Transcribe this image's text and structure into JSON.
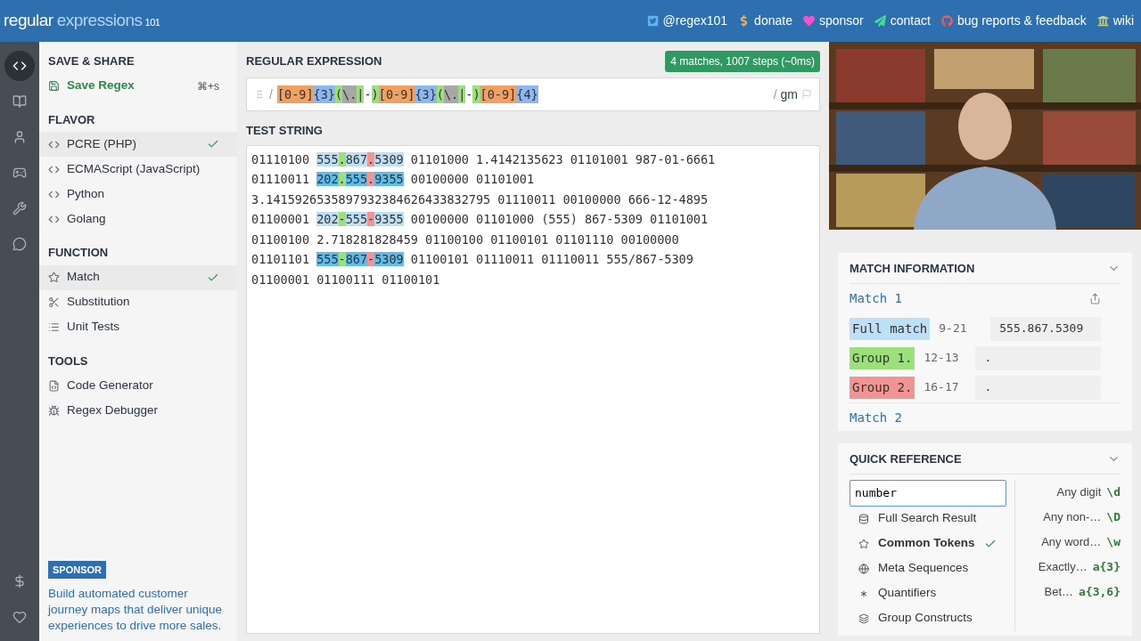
{
  "header": {
    "logo_main": "regular",
    "logo_sub": "expressions",
    "logo_num": "101",
    "links": [
      {
        "kind": "twitter",
        "label": "@regex101"
      },
      {
        "kind": "donate",
        "label": "donate"
      },
      {
        "kind": "sponsor",
        "label": "sponsor"
      },
      {
        "kind": "contact",
        "label": "contact"
      },
      {
        "kind": "bugs",
        "label": "bug reports & feedback"
      },
      {
        "kind": "wiki",
        "label": "wiki"
      }
    ]
  },
  "rail": [
    {
      "kind": "code",
      "selected": true
    },
    {
      "kind": "library",
      "selected": false
    },
    {
      "kind": "account",
      "selected": false
    },
    {
      "kind": "quiz",
      "selected": false
    },
    {
      "kind": "settings",
      "selected": false
    },
    {
      "kind": "chat",
      "selected": false
    }
  ],
  "rail_bottom": [
    {
      "kind": "donate"
    },
    {
      "kind": "sponsor"
    }
  ],
  "sidebar": {
    "sections": [
      {
        "title": "SAVE & SHARE",
        "items": [
          {
            "kind": "save",
            "label": "Save Regex",
            "shortcut": "⌘+s",
            "selected": false
          }
        ]
      },
      {
        "title": "FLAVOR",
        "items": [
          {
            "kind": "code",
            "label": "PCRE (PHP)",
            "selected": true
          },
          {
            "kind": "code",
            "label": "ECMAScript (JavaScript)",
            "selected": false
          },
          {
            "kind": "code",
            "label": "Python",
            "selected": false
          },
          {
            "kind": "code",
            "label": "Golang",
            "selected": false
          }
        ]
      },
      {
        "title": "FUNCTION",
        "items": [
          {
            "kind": "match",
            "label": "Match",
            "selected": true
          },
          {
            "kind": "substitution",
            "label": "Substitution",
            "selected": false
          },
          {
            "kind": "unittests",
            "label": "Unit Tests",
            "selected": false
          }
        ]
      },
      {
        "title": "TOOLS",
        "items": [
          {
            "kind": "codegen",
            "label": "Code Generator",
            "selected": false
          },
          {
            "kind": "debugger",
            "label": "Regex Debugger",
            "selected": false
          }
        ]
      }
    ],
    "sponsor": {
      "badge": "SPONSOR",
      "text": "Build automated customer journey maps that deliver unique experiences to drive more sales."
    }
  },
  "regex": {
    "title": "REGULAR EXPRESSION",
    "status": "4 matches, 1007 steps (~0ms)",
    "open": "/",
    "close": "/",
    "flags": "gm",
    "tokens": [
      {
        "text": "[0-9]",
        "kind": "class"
      },
      {
        "text": "{3}",
        "kind": "quant"
      },
      {
        "text": "(",
        "kind": "group"
      },
      {
        "text": "\\.",
        "kind": "escape"
      },
      {
        "text": "|",
        "kind": "group"
      },
      {
        "text": "-",
        "kind": "literal"
      },
      {
        "text": ")",
        "kind": "group"
      },
      {
        "text": "[0-9]",
        "kind": "class"
      },
      {
        "text": "{3}",
        "kind": "quant"
      },
      {
        "text": "(",
        "kind": "group"
      },
      {
        "text": "\\.",
        "kind": "escape"
      },
      {
        "text": "|",
        "kind": "group"
      },
      {
        "text": "-",
        "kind": "literal"
      },
      {
        "text": ")",
        "kind": "group"
      },
      {
        "text": "[0-9]",
        "kind": "class"
      },
      {
        "text": "{4}",
        "kind": "quant"
      }
    ]
  },
  "test_string": {
    "title": "TEST STRING",
    "lines": [
      [
        {
          "text": "01110100 ",
          "kind": "text"
        },
        {
          "text": "555",
          "kind": "match_a"
        },
        {
          "text": ".",
          "kind": "group1"
        },
        {
          "text": "867",
          "kind": "match_a"
        },
        {
          "text": ".",
          "kind": "group2"
        },
        {
          "text": "5309",
          "kind": "match_a"
        },
        {
          "text": " 01101000 1.4142135623 01101001 987-01-6661",
          "kind": "text"
        }
      ],
      [
        {
          "text": "01110011 ",
          "kind": "text"
        },
        {
          "text": "202",
          "kind": "match_b"
        },
        {
          "text": ".",
          "kind": "group1"
        },
        {
          "text": "555",
          "kind": "match_b"
        },
        {
          "text": ".",
          "kind": "group2"
        },
        {
          "text": "9355",
          "kind": "match_b"
        },
        {
          "text": " 00100000 01101001",
          "kind": "text"
        }
      ],
      [
        {
          "text": "3.1415926535897932384626433832795 01110011 00100000 666-12-4895",
          "kind": "text"
        }
      ],
      [
        {
          "text": "01100001 ",
          "kind": "text"
        },
        {
          "text": "202",
          "kind": "match_a"
        },
        {
          "text": "-",
          "kind": "group1"
        },
        {
          "text": "555",
          "kind": "match_a"
        },
        {
          "text": "-",
          "kind": "group2"
        },
        {
          "text": "9355",
          "kind": "match_a"
        },
        {
          "text": " 00100000 01101000 (555) 867-5309 01101001",
          "kind": "text"
        }
      ],
      [
        {
          "text": "01100100 2.718281828459 01100100 01100101 01101110 00100000",
          "kind": "text"
        }
      ],
      [
        {
          "text": "01101101 ",
          "kind": "text"
        },
        {
          "text": "555",
          "kind": "match_b"
        },
        {
          "text": "-",
          "kind": "group1"
        },
        {
          "text": "867",
          "kind": "match_b"
        },
        {
          "text": "-",
          "kind": "group2"
        },
        {
          "text": "5309",
          "kind": "match_b"
        },
        {
          "text": " 01100101 01110011 01110011 555/867-5309",
          "kind": "text"
        }
      ],
      [
        {
          "text": "01100001 01100111 01100101",
          "kind": "text"
        }
      ]
    ]
  },
  "match_information": {
    "title": "MATCH INFORMATION",
    "matches": [
      {
        "title": "Match 1",
        "rows": [
          {
            "kind": "full",
            "label": "Full match",
            "range": "9-21",
            "value": "555.867.5309"
          },
          {
            "kind": "group1",
            "label": "Group 1.",
            "range": "12-13",
            "value": "."
          },
          {
            "kind": "group2",
            "label": "Group 2.",
            "range": "16-17",
            "value": "."
          }
        ]
      },
      {
        "title": "Match 2"
      }
    ]
  },
  "quick_reference": {
    "title": "QUICK REFERENCE",
    "search": {
      "value": "number"
    },
    "categories": [
      {
        "kind": "search",
        "label": "Full Search Result",
        "selected": false
      },
      {
        "kind": "common",
        "label": "Common Tokens",
        "selected": true
      },
      {
        "kind": "meta",
        "label": "Meta Sequences",
        "selected": false
      },
      {
        "kind": "quant",
        "label": "Quantifiers",
        "selected": false
      },
      {
        "kind": "group",
        "label": "Group Constructs",
        "selected": false
      }
    ],
    "tokens": [
      {
        "description": "Any digit",
        "token": "\\d"
      },
      {
        "description": "Any non-…",
        "token": "\\D"
      },
      {
        "description": "Any word…",
        "token": "\\w"
      },
      {
        "description": "Exactly…",
        "token": "a{3}"
      },
      {
        "description": "Bet…",
        "token": "a{3,6}"
      }
    ]
  }
}
